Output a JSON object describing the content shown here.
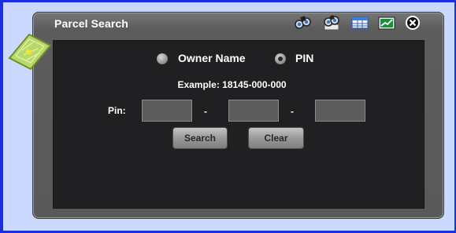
{
  "window": {
    "title": "Parcel Search"
  },
  "toolbar": {
    "icons": [
      "binoculars-icon",
      "binoculars-map-icon",
      "table-icon",
      "chart-icon",
      "close-icon"
    ]
  },
  "search_mode": {
    "options": [
      {
        "label": "Owner Name",
        "selected": false
      },
      {
        "label": "PIN",
        "selected": true
      }
    ]
  },
  "pin": {
    "example": "Example: 18145-000-000",
    "label": "Pin:",
    "separator": "-",
    "fields": [
      "",
      "",
      ""
    ]
  },
  "buttons": {
    "search": "Search",
    "clear": "Clear"
  },
  "colors": {
    "frame": "#1a2ee6",
    "background": "#ccd9ff",
    "window": "#595959",
    "panel": "#202022",
    "badge": "#b7d86a"
  }
}
